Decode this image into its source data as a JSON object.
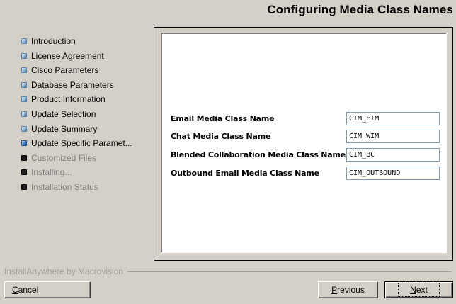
{
  "header": {
    "title": "Configuring Media Class Names"
  },
  "steps": [
    {
      "label": "Introduction",
      "state": "done"
    },
    {
      "label": "License Agreement",
      "state": "done"
    },
    {
      "label": "Cisco Parameters",
      "state": "done"
    },
    {
      "label": "Database Parameters",
      "state": "done"
    },
    {
      "label": "Product Information",
      "state": "done"
    },
    {
      "label": "Update Selection",
      "state": "done"
    },
    {
      "label": "Update Summary",
      "state": "done"
    },
    {
      "label": "Update Specific Paramet...",
      "state": "current"
    },
    {
      "label": "Customized Files",
      "state": "pending"
    },
    {
      "label": "Installing...",
      "state": "pending"
    },
    {
      "label": "Installation Status",
      "state": "pending"
    }
  ],
  "form": {
    "fields": [
      {
        "label": "Email Media Class Name",
        "value": "CIM_EIM"
      },
      {
        "label": "Chat Media Class Name",
        "value": "CIM_WIM"
      },
      {
        "label": "Blended Collaboration Media Class Name",
        "value": "CIM_BC"
      },
      {
        "label": "Outbound Email Media Class Name",
        "value": "CIM_OUTBOUND"
      }
    ]
  },
  "footer": {
    "brand": "InstallAnywhere by Macrovision",
    "cancel": {
      "mnemonic": "C",
      "rest": "ancel"
    },
    "previous": {
      "mnemonic": "P",
      "rest": "revious"
    },
    "next": {
      "mnemonic": "N",
      "rest": "ext"
    }
  },
  "colors": {
    "background": "#d4d0c8",
    "step_done": "#8fb8d8",
    "step_current": "#3b7dc4",
    "step_pending": "#1e1e1e",
    "pending_text": "#808080",
    "brand_text": "#a0a0a0"
  }
}
